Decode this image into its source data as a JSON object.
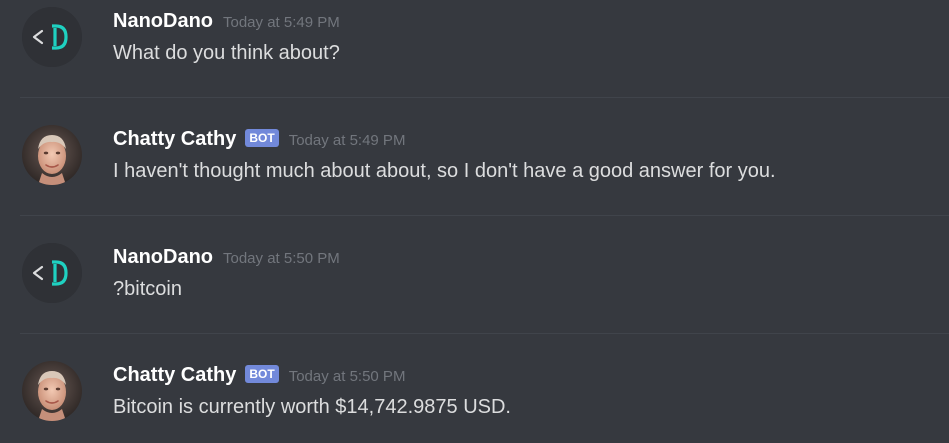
{
  "messages": [
    {
      "author": "NanoDano",
      "avatar_icon": "code-bracket-icon",
      "is_bot": false,
      "timestamp": "Today at 5:49 PM",
      "text": "What do you think about?"
    },
    {
      "author": "Chatty Cathy",
      "avatar_icon": "robot-face-avatar",
      "is_bot": true,
      "bot_tag": "BOT",
      "timestamp": "Today at 5:49 PM",
      "text": "I haven't thought much about about, so I don't have a good answer for you."
    },
    {
      "author": "NanoDano",
      "avatar_icon": "code-bracket-icon",
      "is_bot": false,
      "timestamp": "Today at 5:50 PM",
      "text": "?bitcoin"
    },
    {
      "author": "Chatty Cathy",
      "avatar_icon": "robot-face-avatar",
      "is_bot": true,
      "bot_tag": "BOT",
      "timestamp": "Today at 5:50 PM",
      "text": "Bitcoin is currently worth $14,742.9875 USD."
    }
  ],
  "colors": {
    "background": "#36393f",
    "username": "#ffffff",
    "message_text": "#dcddde",
    "timestamp": "#72767d",
    "bot_tag": "#7289da",
    "code_avatar_accent": "#1fd1c1"
  }
}
